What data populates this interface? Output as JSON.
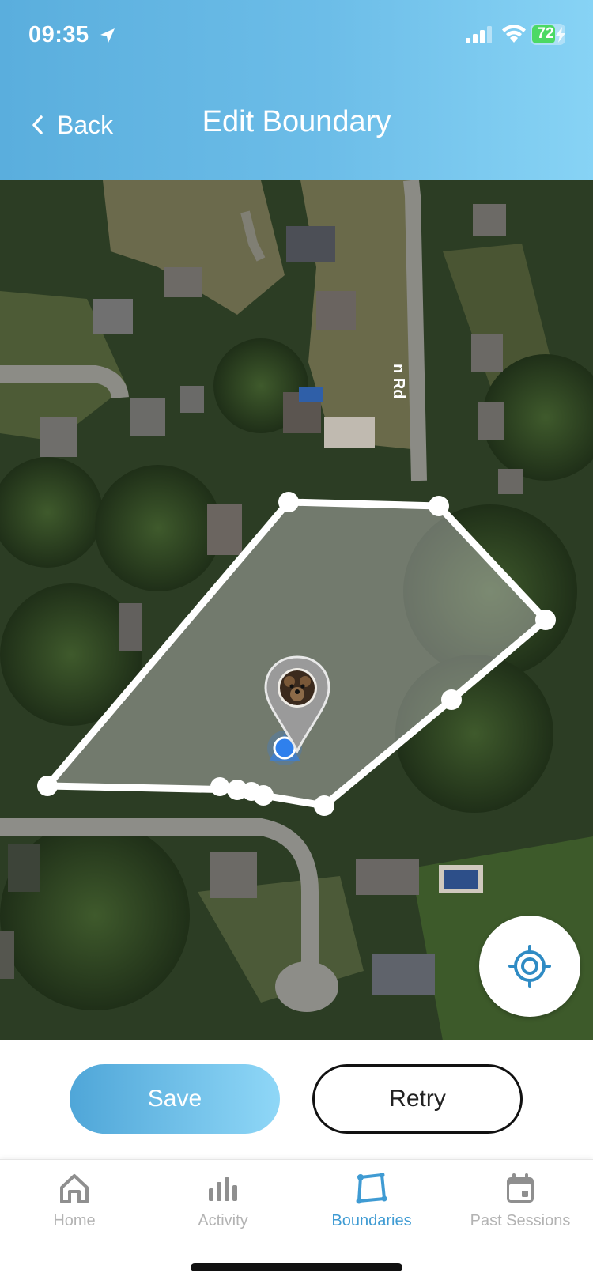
{
  "status_bar": {
    "time": "09:35",
    "battery": "72",
    "battery_level": 0.72
  },
  "header": {
    "back_label": "Back",
    "title": "Edit Boundary"
  },
  "map": {
    "road_label": "n Rd"
  },
  "actions": {
    "save_label": "Save",
    "retry_label": "Retry"
  },
  "tabbar": {
    "items": [
      {
        "label": "Home",
        "icon": "home-icon"
      },
      {
        "label": "Activity",
        "icon": "activity-icon"
      },
      {
        "label": "Boundaries",
        "icon": "boundaries-icon"
      },
      {
        "label": "Past Sessions",
        "icon": "calendar-icon"
      }
    ],
    "active": "Boundaries"
  },
  "colors": {
    "accent": "#3f9bd3",
    "header_start": "#5aaedd",
    "header_end": "#87d3f5",
    "boundary": "#ffffff",
    "location_dot": "#2f80ed"
  }
}
